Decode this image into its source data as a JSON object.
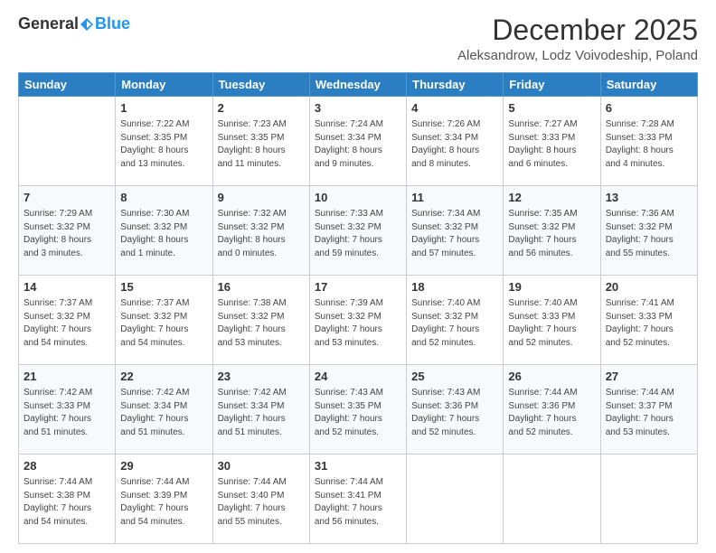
{
  "logo": {
    "general": "General",
    "blue": "Blue"
  },
  "header": {
    "title": "December 2025",
    "subtitle": "Aleksandrow, Lodz Voivodeship, Poland"
  },
  "days_of_week": [
    "Sunday",
    "Monday",
    "Tuesday",
    "Wednesday",
    "Thursday",
    "Friday",
    "Saturday"
  ],
  "weeks": [
    [
      {
        "day": "",
        "info": ""
      },
      {
        "day": "1",
        "info": "Sunrise: 7:22 AM\nSunset: 3:35 PM\nDaylight: 8 hours\nand 13 minutes."
      },
      {
        "day": "2",
        "info": "Sunrise: 7:23 AM\nSunset: 3:35 PM\nDaylight: 8 hours\nand 11 minutes."
      },
      {
        "day": "3",
        "info": "Sunrise: 7:24 AM\nSunset: 3:34 PM\nDaylight: 8 hours\nand 9 minutes."
      },
      {
        "day": "4",
        "info": "Sunrise: 7:26 AM\nSunset: 3:34 PM\nDaylight: 8 hours\nand 8 minutes."
      },
      {
        "day": "5",
        "info": "Sunrise: 7:27 AM\nSunset: 3:33 PM\nDaylight: 8 hours\nand 6 minutes."
      },
      {
        "day": "6",
        "info": "Sunrise: 7:28 AM\nSunset: 3:33 PM\nDaylight: 8 hours\nand 4 minutes."
      }
    ],
    [
      {
        "day": "7",
        "info": "Sunrise: 7:29 AM\nSunset: 3:32 PM\nDaylight: 8 hours\nand 3 minutes."
      },
      {
        "day": "8",
        "info": "Sunrise: 7:30 AM\nSunset: 3:32 PM\nDaylight: 8 hours\nand 1 minute."
      },
      {
        "day": "9",
        "info": "Sunrise: 7:32 AM\nSunset: 3:32 PM\nDaylight: 8 hours\nand 0 minutes."
      },
      {
        "day": "10",
        "info": "Sunrise: 7:33 AM\nSunset: 3:32 PM\nDaylight: 7 hours\nand 59 minutes."
      },
      {
        "day": "11",
        "info": "Sunrise: 7:34 AM\nSunset: 3:32 PM\nDaylight: 7 hours\nand 57 minutes."
      },
      {
        "day": "12",
        "info": "Sunrise: 7:35 AM\nSunset: 3:32 PM\nDaylight: 7 hours\nand 56 minutes."
      },
      {
        "day": "13",
        "info": "Sunrise: 7:36 AM\nSunset: 3:32 PM\nDaylight: 7 hours\nand 55 minutes."
      }
    ],
    [
      {
        "day": "14",
        "info": "Sunrise: 7:37 AM\nSunset: 3:32 PM\nDaylight: 7 hours\nand 54 minutes."
      },
      {
        "day": "15",
        "info": "Sunrise: 7:37 AM\nSunset: 3:32 PM\nDaylight: 7 hours\nand 54 minutes."
      },
      {
        "day": "16",
        "info": "Sunrise: 7:38 AM\nSunset: 3:32 PM\nDaylight: 7 hours\nand 53 minutes."
      },
      {
        "day": "17",
        "info": "Sunrise: 7:39 AM\nSunset: 3:32 PM\nDaylight: 7 hours\nand 53 minutes."
      },
      {
        "day": "18",
        "info": "Sunrise: 7:40 AM\nSunset: 3:32 PM\nDaylight: 7 hours\nand 52 minutes."
      },
      {
        "day": "19",
        "info": "Sunrise: 7:40 AM\nSunset: 3:33 PM\nDaylight: 7 hours\nand 52 minutes."
      },
      {
        "day": "20",
        "info": "Sunrise: 7:41 AM\nSunset: 3:33 PM\nDaylight: 7 hours\nand 52 minutes."
      }
    ],
    [
      {
        "day": "21",
        "info": "Sunrise: 7:42 AM\nSunset: 3:33 PM\nDaylight: 7 hours\nand 51 minutes."
      },
      {
        "day": "22",
        "info": "Sunrise: 7:42 AM\nSunset: 3:34 PM\nDaylight: 7 hours\nand 51 minutes."
      },
      {
        "day": "23",
        "info": "Sunrise: 7:42 AM\nSunset: 3:34 PM\nDaylight: 7 hours\nand 51 minutes."
      },
      {
        "day": "24",
        "info": "Sunrise: 7:43 AM\nSunset: 3:35 PM\nDaylight: 7 hours\nand 52 minutes."
      },
      {
        "day": "25",
        "info": "Sunrise: 7:43 AM\nSunset: 3:36 PM\nDaylight: 7 hours\nand 52 minutes."
      },
      {
        "day": "26",
        "info": "Sunrise: 7:44 AM\nSunset: 3:36 PM\nDaylight: 7 hours\nand 52 minutes."
      },
      {
        "day": "27",
        "info": "Sunrise: 7:44 AM\nSunset: 3:37 PM\nDaylight: 7 hours\nand 53 minutes."
      }
    ],
    [
      {
        "day": "28",
        "info": "Sunrise: 7:44 AM\nSunset: 3:38 PM\nDaylight: 7 hours\nand 54 minutes."
      },
      {
        "day": "29",
        "info": "Sunrise: 7:44 AM\nSunset: 3:39 PM\nDaylight: 7 hours\nand 54 minutes."
      },
      {
        "day": "30",
        "info": "Sunrise: 7:44 AM\nSunset: 3:40 PM\nDaylight: 7 hours\nand 55 minutes."
      },
      {
        "day": "31",
        "info": "Sunrise: 7:44 AM\nSunset: 3:41 PM\nDaylight: 7 hours\nand 56 minutes."
      },
      {
        "day": "",
        "info": ""
      },
      {
        "day": "",
        "info": ""
      },
      {
        "day": "",
        "info": ""
      }
    ]
  ]
}
